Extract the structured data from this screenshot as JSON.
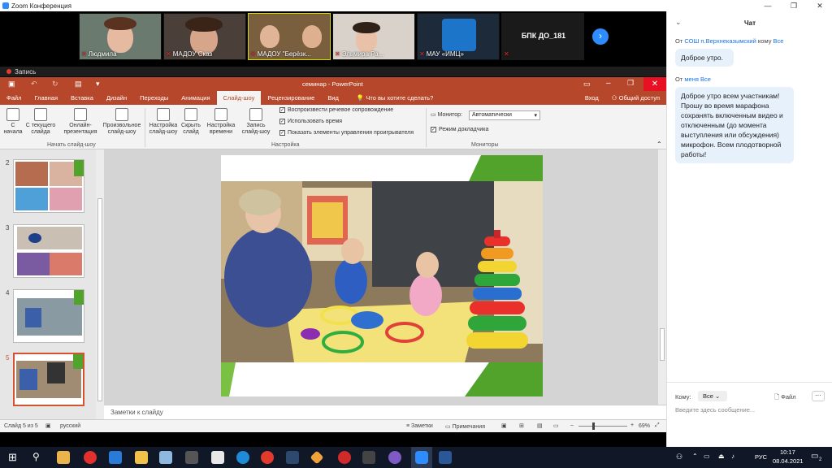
{
  "zoom": {
    "title": "Zoom Конференция"
  },
  "participants": [
    {
      "name": "Людмила"
    },
    {
      "name": "МАДОУ Сказ"
    },
    {
      "name": "МАДОУ \"Берёзк..."
    },
    {
      "name": "Эльмира Ра..."
    },
    {
      "name": "МАУ «ИМЦ»"
    },
    {
      "name": "БПК ДО_181"
    }
  ],
  "recording": {
    "label": "Запись"
  },
  "powerpoint": {
    "title": "семинар - PowerPoint",
    "search_placeholder": "Что вы хотите сделать?",
    "signin": "Вход",
    "share": "Общий доступ",
    "tabs": [
      "Файл",
      "Главная",
      "Вставка",
      "Дизайн",
      "Переходы",
      "Анимация",
      "Слайд-шоу",
      "Рецензирование",
      "Вид"
    ],
    "ribbon": {
      "from_start": "С начала",
      "from_current": "С текущего слайда",
      "online": "Онлайн-презентация",
      "custom": "Произвольное слайд-шоу",
      "setup": "Настройка слайд-шоу",
      "hide": "Скрыть слайд",
      "rehearse": "Настройка времени",
      "record": "Запись слайд-шоу",
      "chk_narration": "Воспроизвести речевое сопровождение",
      "chk_timings": "Использовать время",
      "chk_controls": "Показать элементы управления проигрывателя",
      "monitor_label": "Монитор:",
      "monitor_value": "Автоматически",
      "presenter_view": "Режим докладчика",
      "group_start": "Начать слайд-шоу",
      "group_setup": "Настройка",
      "group_monitors": "Мониторы"
    },
    "slides": [
      "2",
      "3",
      "4",
      "5"
    ],
    "notes_placeholder": "Заметки к слайду",
    "status": {
      "slide_info": "Слайд 5 из 5",
      "language": "русский",
      "notes": "Заметки",
      "comments": "Примечания",
      "zoom": "69%"
    }
  },
  "chat": {
    "title": "Чат",
    "messages": [
      {
        "from_prefix": "От",
        "sender": "СОШ п.Верхнеказымский",
        "to_prefix": "кому",
        "to": "Все",
        "text": "Доброе утро."
      },
      {
        "from_prefix": "От",
        "sender": "меня",
        "to_prefix": "",
        "to": "Все",
        "text": "Доброе утро всем участникам! Прошу во время марафона сохранять включенным видео и отключенным (до момента выступления или обсуждения) микрофон. Всем плодотворной работы!"
      }
    ],
    "to_label": "Кому:",
    "to_value": "Все",
    "file_label": "Файл",
    "input_placeholder": "Введите здесь сообщение..."
  },
  "taskbar": {
    "lang": "РУС",
    "time": "10:17",
    "date": "08.04.2021",
    "notif_count": "2"
  },
  "colors": {
    "pp_accent": "#b7472a",
    "zoom_blue": "#2d8cff",
    "chat_bubble": "#e7f1fc"
  }
}
